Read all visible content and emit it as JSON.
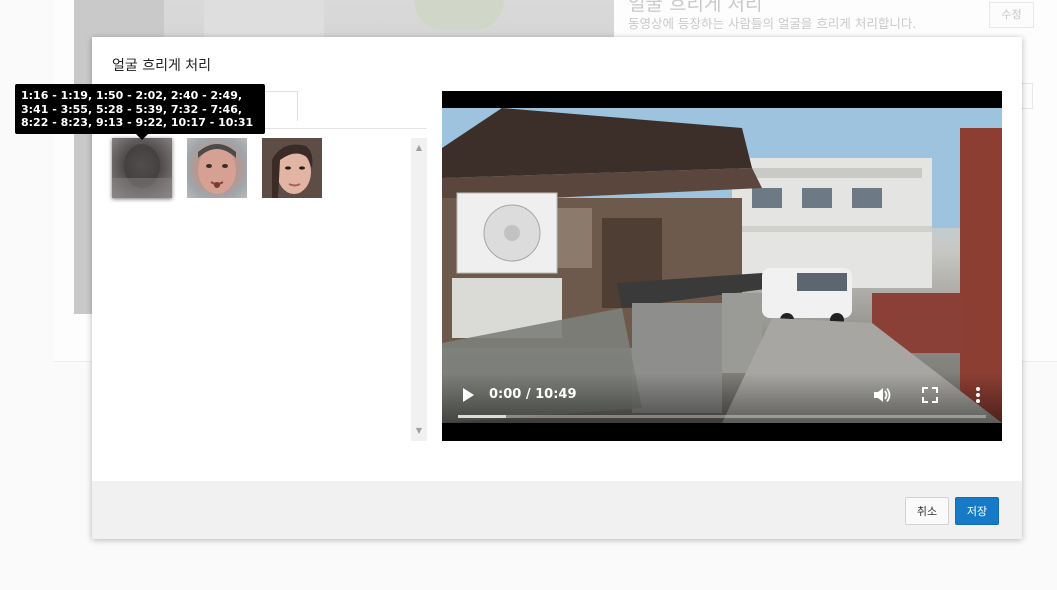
{
  "background": {
    "title": "얼굴 흐리게 처리",
    "description": "동영상에 등장하는 사람들의 얼굴을 흐리게 처리합니다.",
    "edit_button": "수정"
  },
  "modal": {
    "title": "얼굴 흐리게 처리",
    "faces": [
      {
        "icon": "blurred-face-thumbnail",
        "selected": true
      },
      {
        "icon": "man-face-thumbnail",
        "selected": false
      },
      {
        "icon": "woman-face-thumbnail",
        "selected": false
      }
    ],
    "tooltip": "1:16 - 1:19, 1:50 - 2:02, 2:40 - 2:49, 3:41 - 3:55, 5:28 - 5:39, 7:32 - 7:46, 8:22 - 8:23, 9:13 - 9:22, 10:17 - 10:31",
    "video": {
      "time_display": "0:00 / 10:49",
      "buffered_fraction": 0.09
    },
    "footer": {
      "cancel_label": "취소",
      "save_label": "저장"
    }
  },
  "colors": {
    "primary": "#167ac6",
    "tooltip_bg": "#000000",
    "footer_bg": "#f1f1f1"
  }
}
